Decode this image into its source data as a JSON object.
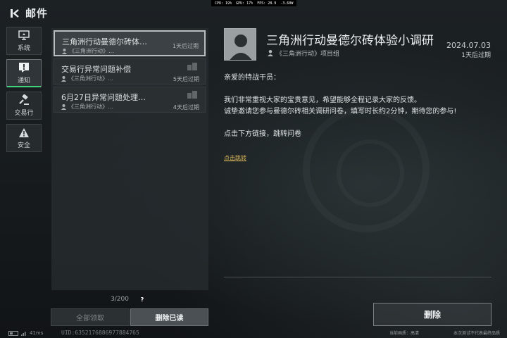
{
  "perf": {
    "cpu": "CPU: 19%",
    "gpu": "GPU: 17%",
    "fps": "FPS: 28.9",
    "power": "-3.60W"
  },
  "header": {
    "title": "邮件",
    "back_icon": "back-arrow-icon"
  },
  "categories": [
    {
      "label": "系统",
      "icon": "monitor-icon",
      "active": false
    },
    {
      "label": "通知",
      "icon": "notice-icon",
      "active": true
    },
    {
      "label": "交易行",
      "icon": "gavel-icon",
      "active": false
    },
    {
      "label": "安全",
      "icon": "warning-icon",
      "active": false
    }
  ],
  "mails": [
    {
      "title": "三角洲行动曼德尔砖体…",
      "sender": "《三角洲行动》…",
      "expiry": "1天后过期",
      "selected": true
    },
    {
      "title": "交易行异常问题补偿",
      "sender": "《三角洲行动》…",
      "expiry": "5天后过期",
      "selected": false
    },
    {
      "title": "6月27日异常问题处理…",
      "sender": "《三角洲行动》…",
      "expiry": "4天后过期",
      "selected": false
    }
  ],
  "list_footer": {
    "page": "3/200",
    "help": "?"
  },
  "buttons": {
    "claim_all": "全部领取",
    "delete_read": "删除已读",
    "delete": "删除"
  },
  "detail": {
    "title": "三角洲行动曼德尔砖体验小调研",
    "sender": "《三角洲行动》项目组",
    "date": "2024.07.03",
    "expiry": "1天后过期",
    "greeting": "亲爱的特战干员：",
    "line1": "我们非常重视大家的宝贵意见，希望能够全程记录大家的反馈。",
    "line2": "诚挚邀请您参与曼德尔砖相关调研问卷，填写时长约2分钟，期待您的参与!",
    "line3": "点击下方链接，跳转问卷",
    "link": "点击跳转"
  },
  "footer": {
    "ping": "41ms",
    "uid": "UID:6352176886977884765",
    "quality": "当前画质：高清",
    "disclaimer": "本次测试不代表最终品质"
  },
  "colors": {
    "accent": "#3fd37c",
    "link": "#d7b35a"
  }
}
